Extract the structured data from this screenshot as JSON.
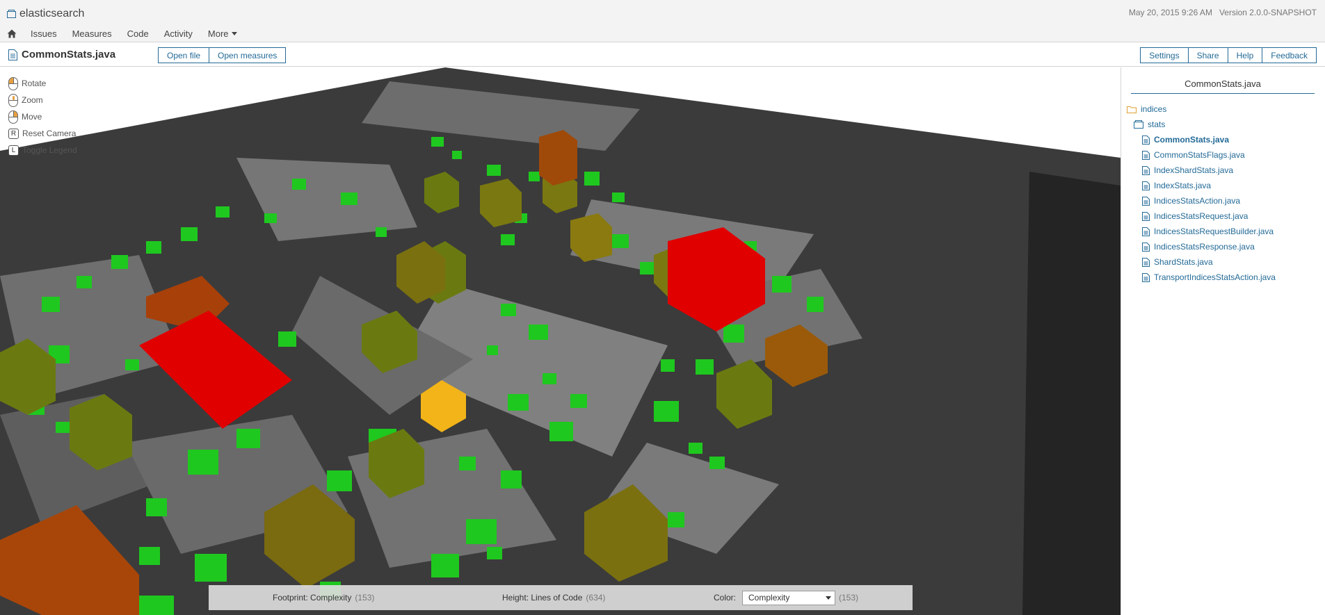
{
  "header": {
    "project_name": "elasticsearch",
    "date": "May 20, 2015 9:26 AM",
    "version": "Version 2.0.0-SNAPSHOT"
  },
  "nav": {
    "items": [
      {
        "label": "Issues"
      },
      {
        "label": "Measures"
      },
      {
        "label": "Code"
      },
      {
        "label": "Activity"
      },
      {
        "label": "More"
      }
    ]
  },
  "component": {
    "title": "CommonStats.java",
    "open_file": "Open file",
    "open_measures": "Open measures",
    "settings": "Settings",
    "share": "Share",
    "help": "Help",
    "feedback": "Feedback"
  },
  "controls": {
    "rotate": "Rotate",
    "zoom": "Zoom",
    "move": "Move",
    "reset_key": "R",
    "reset": "Reset Camera",
    "legend_key": "L",
    "legend": "Toggle Legend"
  },
  "legend": {
    "footprint_label": "Footprint: Complexity",
    "footprint_count": "(153)",
    "height_label": "Height: Lines of Code",
    "height_count": "(634)",
    "color_label": "Color:",
    "color_value": "Complexity",
    "color_count": "(153)"
  },
  "sidebar": {
    "title": "CommonStats.java",
    "folder": "indices",
    "package": "stats",
    "files": [
      {
        "name": "CommonStats.java",
        "current": true
      },
      {
        "name": "CommonStatsFlags.java",
        "current": false
      },
      {
        "name": "IndexShardStats.java",
        "current": false
      },
      {
        "name": "IndexStats.java",
        "current": false
      },
      {
        "name": "IndicesStatsAction.java",
        "current": false
      },
      {
        "name": "IndicesStatsRequest.java",
        "current": false
      },
      {
        "name": "IndicesStatsRequestBuilder.java",
        "current": false
      },
      {
        "name": "IndicesStatsResponse.java",
        "current": false
      },
      {
        "name": "ShardStats.java",
        "current": false
      },
      {
        "name": "TransportIndicesStatsAction.java",
        "current": false
      }
    ]
  },
  "colors": {
    "link": "#236a97",
    "ground": "#3b3b3b",
    "district": "#7a7a7a",
    "low_complexity": "#1fd21f",
    "medium_complexity": "#8a7a10",
    "high_complexity": "#b34a0a",
    "highest_complexity": "#e00000",
    "selected": "#f2b418"
  }
}
